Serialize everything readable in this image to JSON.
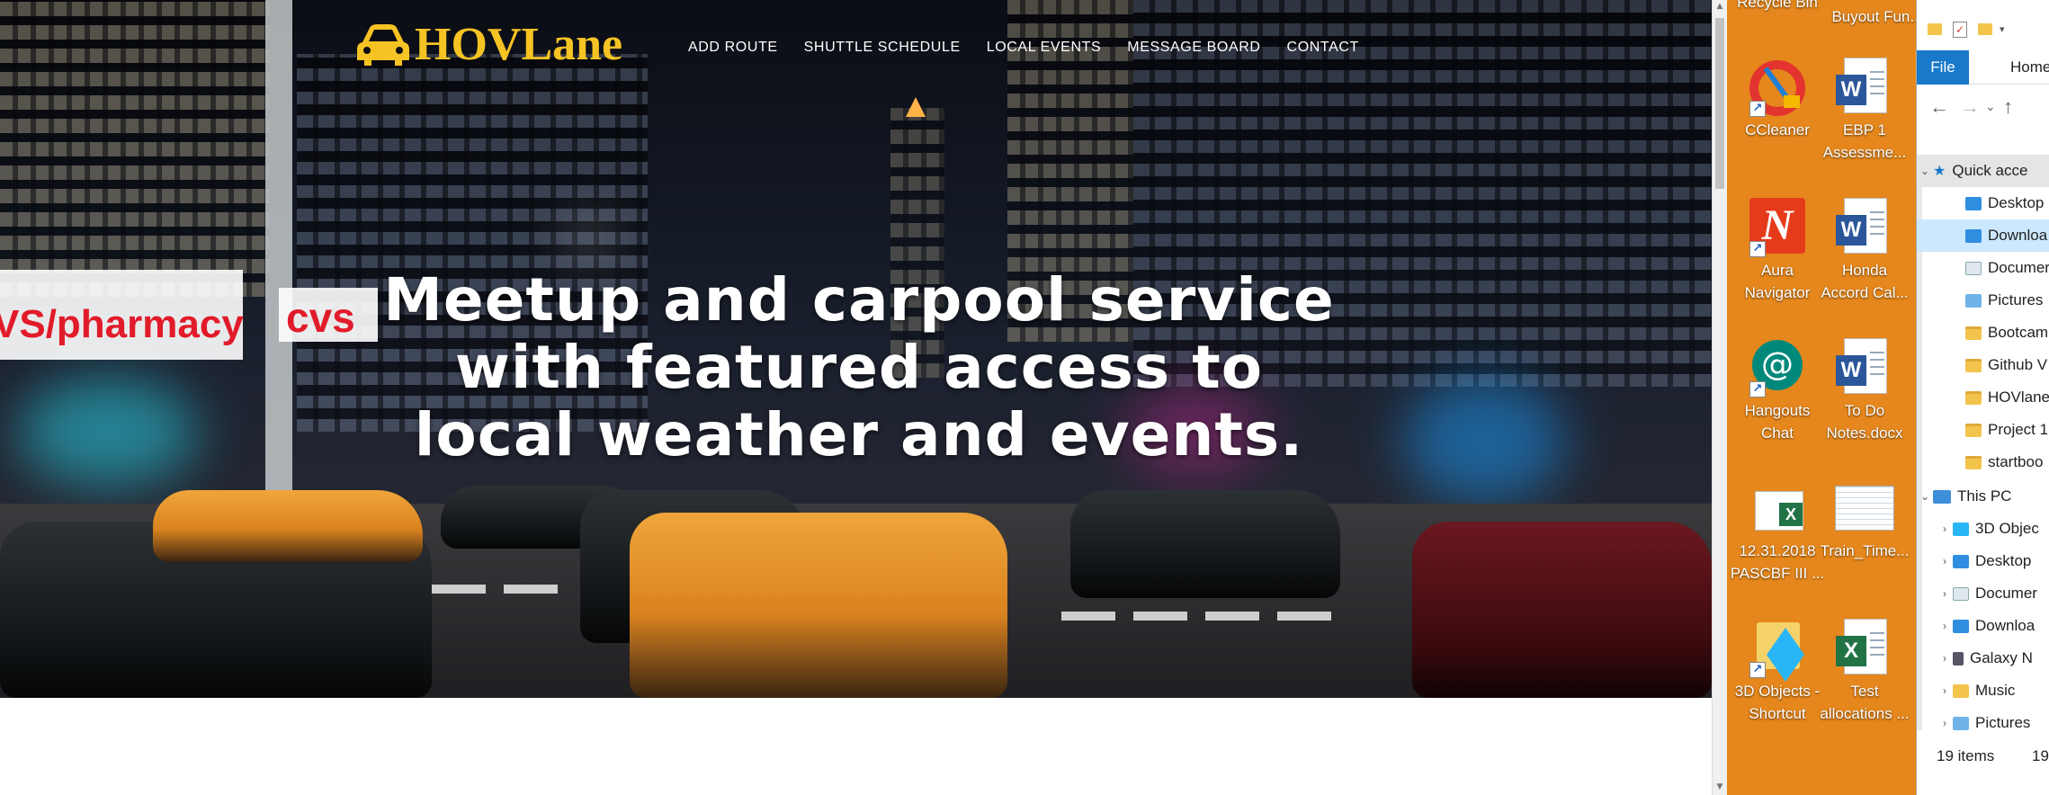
{
  "browser_page": {
    "logo_text": "HOVLane",
    "nav": [
      "ADD ROUTE",
      "SHUTTLE SCHEDULE",
      "LOCAL EVENTS",
      "MESSAGE BOARD",
      "CONTACT"
    ],
    "headline": [
      "Meetup and carpool service",
      "with featured access to",
      "local weather and events."
    ],
    "hero_signs": [
      "VS/pharmacy",
      "cvs",
      "pharmacy"
    ],
    "logo_color": "#f6c324"
  },
  "desktop": {
    "background_color": "#e5871c",
    "top_fragments": [
      "Recycle Bin",
      "Buyout Fun..."
    ],
    "icons": [
      {
        "label_lines": [
          "CCleaner"
        ],
        "icon": "ccleaner-icon"
      },
      {
        "label_lines": [
          "EBP 1",
          "Assessme..."
        ],
        "icon": "word-doc-icon"
      },
      {
        "label_lines": [
          "Aura",
          "Navigator"
        ],
        "icon": "aura-navigator-icon"
      },
      {
        "label_lines": [
          "Honda",
          "Accord Cal..."
        ],
        "icon": "word-doc-icon"
      },
      {
        "label_lines": [
          "Hangouts",
          "Chat"
        ],
        "icon": "hangouts-chat-icon"
      },
      {
        "label_lines": [
          "To Do",
          "Notes.docx"
        ],
        "icon": "word-doc-icon"
      },
      {
        "label_lines": [
          "12.31.2018",
          "PASCBF III ..."
        ],
        "icon": "excel-icon"
      },
      {
        "label_lines": [
          "Train_Time..."
        ],
        "icon": "spreadsheet-thumb-icon"
      },
      {
        "label_lines": [
          "3D Objects -",
          "Shortcut"
        ],
        "icon": "3d-objects-icon"
      },
      {
        "label_lines": [
          "Test",
          "allocations ..."
        ],
        "icon": "excel-icon"
      }
    ]
  },
  "explorer": {
    "tabs": {
      "file": "File",
      "home": "Home"
    },
    "quick_access_label": "Quick acce",
    "quick_access_items": [
      "Desktop",
      "Downloa",
      "Documer",
      "Pictures",
      "Bootcam",
      "Github V",
      "HOVlane",
      "Project 1",
      "startboo"
    ],
    "this_pc_label": "This PC",
    "this_pc_items": [
      "3D Objec",
      "Desktop",
      "Documer",
      "Downloa",
      "Galaxy N",
      "Music",
      "Pictures"
    ],
    "status_items": "19 items",
    "status_extra": "19"
  }
}
